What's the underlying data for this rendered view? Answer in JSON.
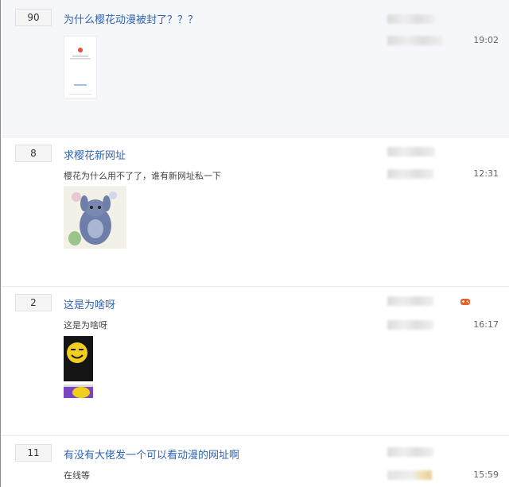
{
  "threads": [
    {
      "reply_count": "90",
      "title": "为什么樱花动漫被封了？？？",
      "abstract": "",
      "time": "19:02"
    },
    {
      "reply_count": "8",
      "title": "求樱花新网址",
      "abstract": "樱花为什么用不了了，谁有新网址私一下",
      "time": "12:31"
    },
    {
      "reply_count": "2",
      "title": "这是为啥呀",
      "abstract": "这是为啥呀",
      "time": "16:17"
    },
    {
      "reply_count": "11",
      "title": "有没有大佬发一个可以看动漫的网址啊",
      "abstract": "在线等",
      "time": "15:59"
    }
  ],
  "icons": {
    "game_badge": "gamepad-icon"
  },
  "colors": {
    "title_link": "#2d64b3",
    "highlight_row_bg": "#f5f7fb",
    "game_badge": "#e8622c"
  }
}
